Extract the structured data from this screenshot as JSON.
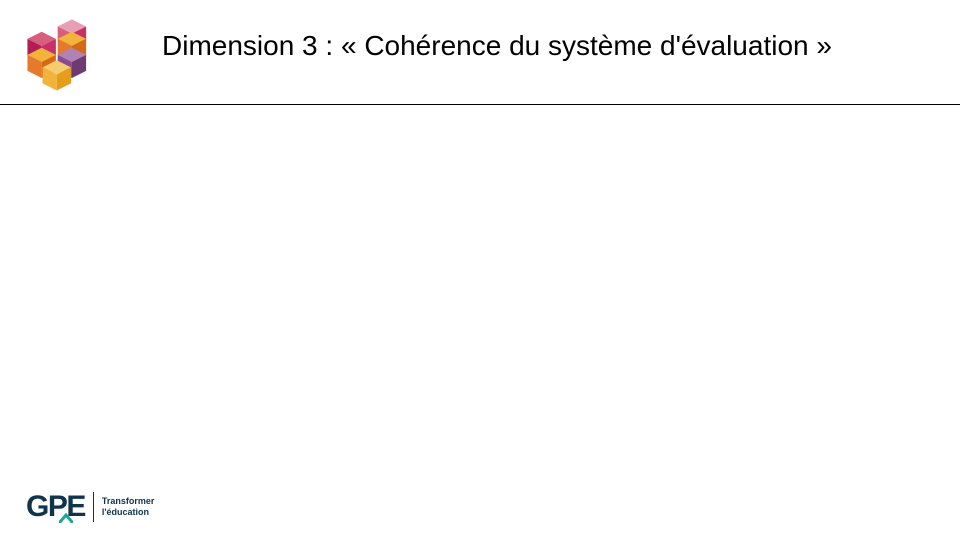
{
  "header": {
    "title": "Dimension 3 : « Cohérence du système d'évaluation »"
  },
  "footer": {
    "brand": "GPE",
    "tagline_line1": "Transformer",
    "tagline_line2": "l'éducation"
  },
  "colors": {
    "magenta": "#c92f6b",
    "orange": "#e57a2f",
    "amber": "#f2b33a",
    "purple": "#8a4b90",
    "pink": "#d85e7e",
    "navy": "#10344a",
    "teal": "#1aa695"
  }
}
